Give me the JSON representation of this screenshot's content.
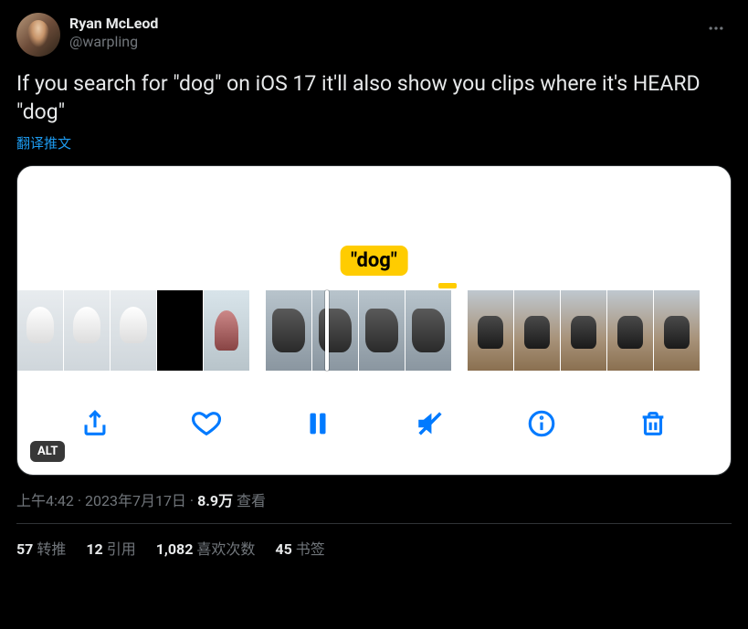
{
  "author": {
    "display_name": "Ryan McLeod",
    "handle": "@warpling"
  },
  "body": "If you search for \"dog\" on iOS 17 it'll also show you clips where it's HEARD \"dog\"",
  "translate_label": "翻译推文",
  "media": {
    "dog_label": "\"dog\"",
    "alt_badge": "ALT"
  },
  "meta": {
    "time": "上午4:42",
    "date": "2023年7月17日",
    "views_num": "8.9万",
    "views_label": "查看",
    "separator": " · "
  },
  "stats": {
    "retweets_num": "57",
    "retweets_label": "转推",
    "quotes_num": "12",
    "quotes_label": "引用",
    "likes_num": "1,082",
    "likes_label": "喜欢次数",
    "bookmarks_num": "45",
    "bookmarks_label": "书签"
  }
}
